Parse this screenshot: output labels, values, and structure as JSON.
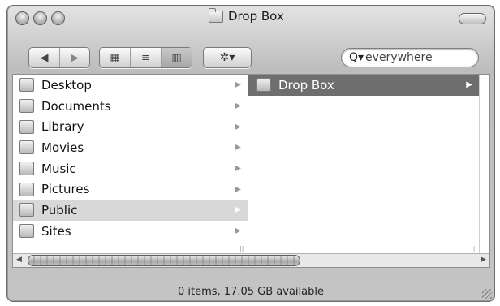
{
  "window": {
    "title": "Drop Box"
  },
  "toolbar": {
    "back_glyph": "◀",
    "forward_glyph": "▶",
    "view_icons_glyph": "▦",
    "view_list_glyph": "≡",
    "view_columns_glyph": "▥",
    "action_glyph": "✲▾",
    "search_glyph": "Q▾",
    "search_value": "everywhere"
  },
  "column1": {
    "items": [
      {
        "label": "Desktop",
        "icon": "desktop-icon"
      },
      {
        "label": "Documents",
        "icon": "documents-folder-icon"
      },
      {
        "label": "Library",
        "icon": "library-folder-icon"
      },
      {
        "label": "Movies",
        "icon": "movies-folder-icon"
      },
      {
        "label": "Music",
        "icon": "music-folder-icon"
      },
      {
        "label": "Pictures",
        "icon": "pictures-folder-icon"
      },
      {
        "label": "Public",
        "icon": "public-folder-icon",
        "selected": true
      },
      {
        "label": "Sites",
        "icon": "sites-folder-icon"
      }
    ]
  },
  "column2": {
    "items": [
      {
        "label": "Drop Box",
        "icon": "dropbox-folder-icon",
        "highlighted": true
      }
    ]
  },
  "arrow_glyph": "▶",
  "statusbar": {
    "text": "0 items, 17.05 GB available"
  },
  "scroll": {
    "left_glyph": "◀",
    "right_glyph": "▶"
  },
  "colors": {
    "highlight": "#6e6e6e",
    "selected": "#d8d8d8"
  }
}
